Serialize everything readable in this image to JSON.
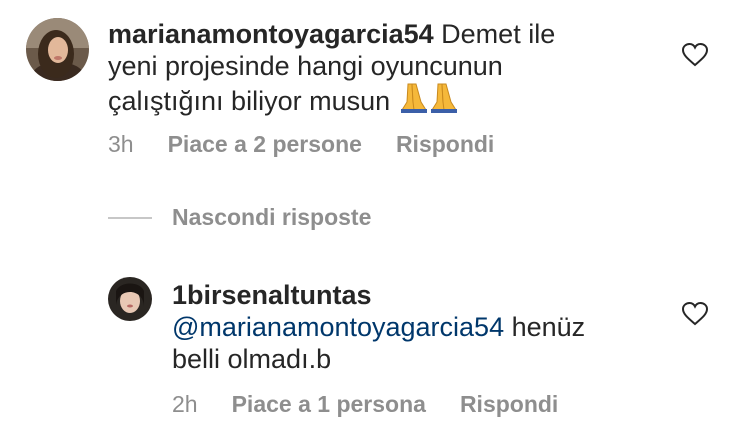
{
  "comment": {
    "username": "marianamontoyagarcia54",
    "text_line1": "Demet ile",
    "text_line2": "yeni projesinde hangi oyuncunun",
    "text_line3": "çalıştığını biliyor musun",
    "emoji": "🙏🙏",
    "time": "3h",
    "likes": "Piace a 2 persone",
    "reply": "Rispondi"
  },
  "hide_replies_label": "Nascondi risposte",
  "reply_comment": {
    "username": "1birsenaltuntas",
    "mention": "@marianamontoyagarcia54",
    "text_after_mention": "henüz",
    "text_line2": "belli olmadı.b",
    "time": "2h",
    "likes": "Piace a 1 persona",
    "reply": "Rispondi"
  },
  "icons": {
    "like": "heart-outline-icon",
    "emoji": "folded-hands-emoji"
  }
}
